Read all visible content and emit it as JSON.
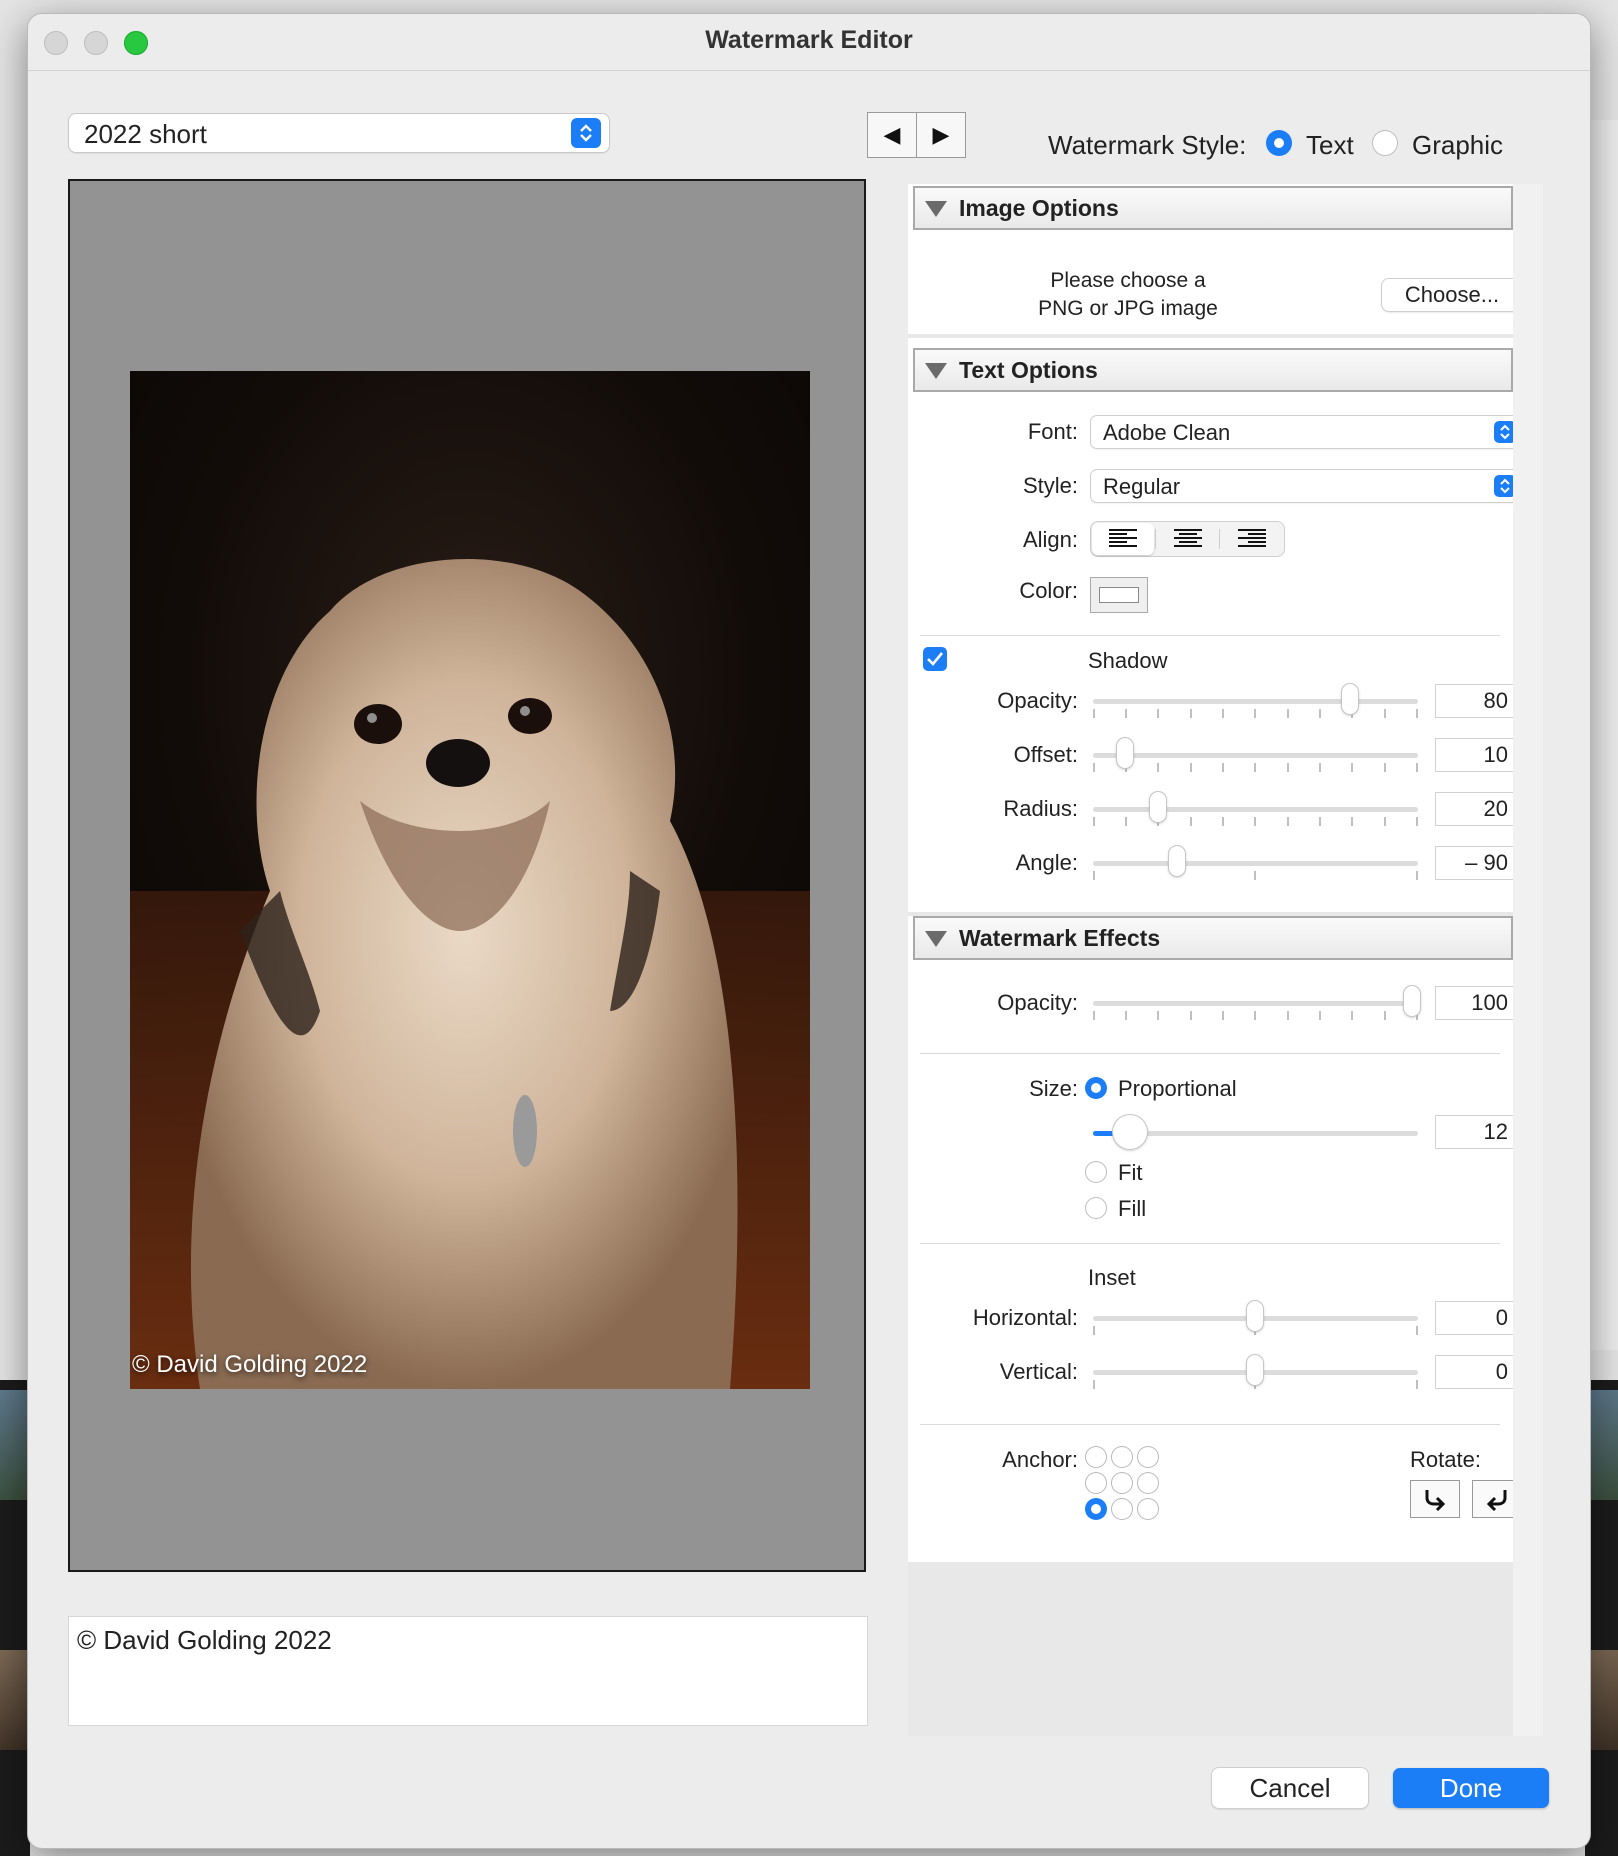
{
  "window": {
    "title": "Watermark Editor",
    "traffic_lights": [
      "#d9d9d9",
      "#d9d9d9",
      "#28c840"
    ]
  },
  "preset": {
    "selected": "2022 short"
  },
  "nav": {
    "prev_icon": "◀",
    "next_icon": "▶"
  },
  "watermark_style": {
    "label": "Watermark Style:",
    "options": [
      "Text",
      "Graphic"
    ],
    "selected": "Text"
  },
  "preview": {
    "watermark_text": "© David Golding 2022"
  },
  "watermark_text": {
    "value": "© David Golding 2022"
  },
  "image_options": {
    "header": "Image Options",
    "prompt_line1": "Please choose a",
    "prompt_line2": "PNG or JPG image",
    "choose_label": "Choose..."
  },
  "text_options": {
    "header": "Text Options",
    "font_label": "Font:",
    "font_value": "Adobe Clean",
    "style_label": "Style:",
    "style_value": "Regular",
    "align_label": "Align:",
    "align_options": [
      "left",
      "center",
      "right"
    ],
    "align_selected": "left",
    "color_label": "Color:",
    "color_value": "#ffffff",
    "shadow": {
      "checked": true,
      "label": "Shadow",
      "opacity_label": "Opacity:",
      "opacity_value": "80",
      "offset_label": "Offset:",
      "offset_value": "10",
      "radius_label": "Radius:",
      "radius_value": "20",
      "angle_label": "Angle:",
      "angle_value": "– 90"
    }
  },
  "effects": {
    "header": "Watermark Effects",
    "opacity_label": "Opacity:",
    "opacity_value": "100",
    "size_label": "Size:",
    "size_options": [
      "Proportional",
      "Fit",
      "Fill"
    ],
    "size_selected": "Proportional",
    "size_value": "12",
    "inset_label": "Inset",
    "horizontal_label": "Horizontal:",
    "horizontal_value": "0",
    "vertical_label": "Vertical:",
    "vertical_value": "0",
    "anchor_label": "Anchor:",
    "anchor_selected": "bottom-left",
    "rotate_label": "Rotate:"
  },
  "footer": {
    "cancel_label": "Cancel",
    "done_label": "Done"
  },
  "colors": {
    "accent": "#1b7ef6"
  }
}
